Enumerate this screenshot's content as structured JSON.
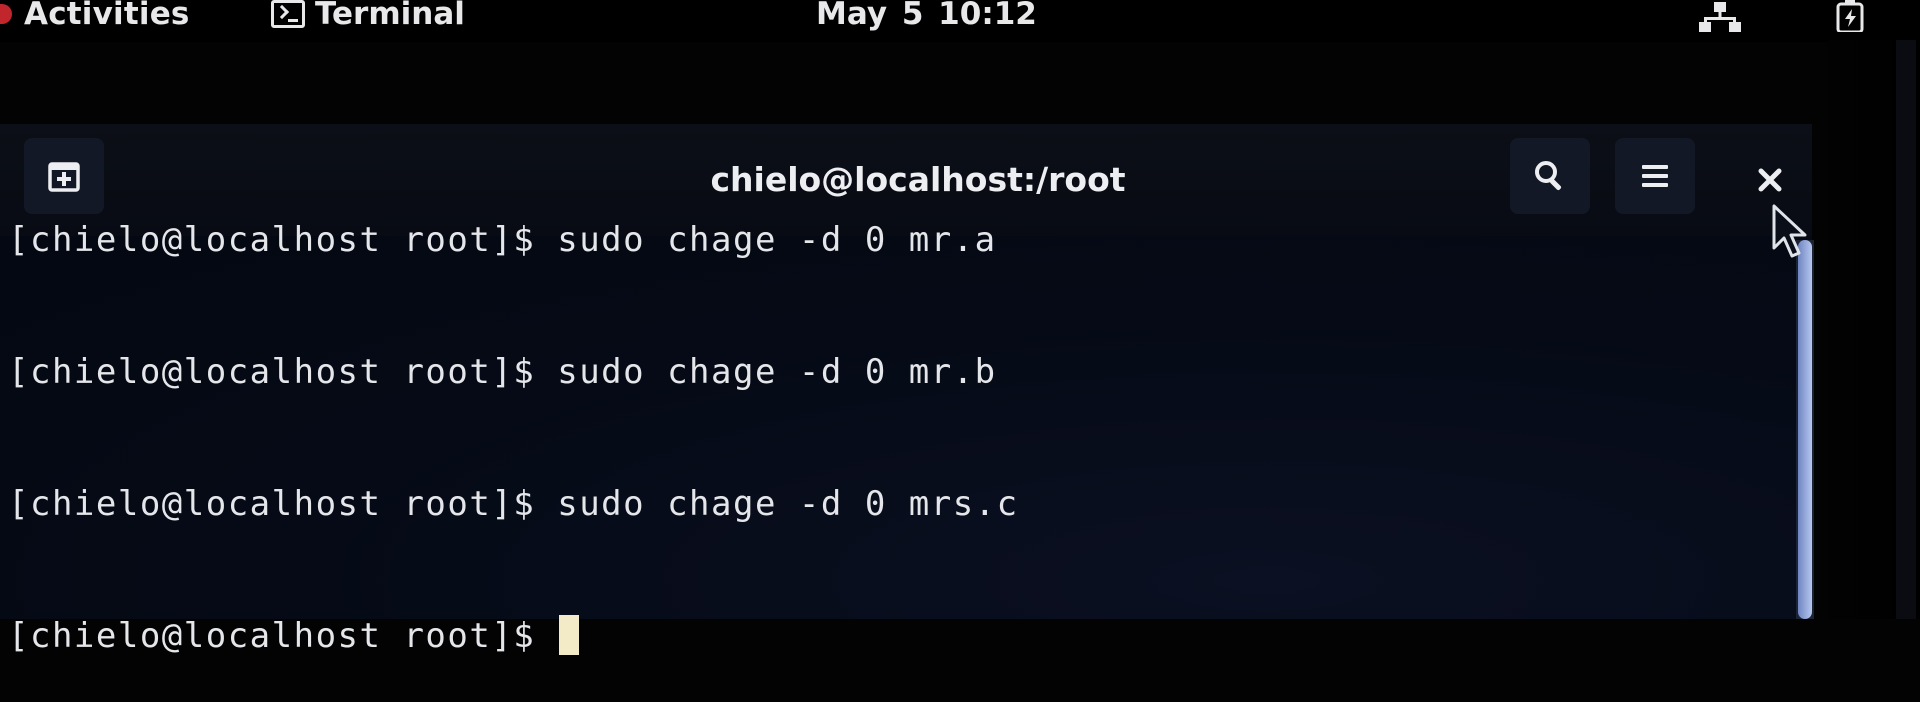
{
  "topbar": {
    "activities_label": "Activities",
    "app_menu_label": "Terminal",
    "clock": "May 5  10:12"
  },
  "window": {
    "title": "chielo@localhost:/root"
  },
  "terminal": {
    "lines": [
      "[chielo@localhost root]$ sudo chage -d 0 mr.a",
      "[chielo@localhost root]$ sudo chage -d 0 mr.b",
      "[chielo@localhost root]$ sudo chage -d 0 mrs.c",
      "[chielo@localhost root]$ "
    ]
  },
  "icons": {
    "top": [
      "activities-indicator-icon",
      "terminal-app-icon",
      "network-icon",
      "power-icon"
    ],
    "headerbar": [
      "new-tab-icon",
      "search-icon",
      "hamburger-menu-icon",
      "close-icon"
    ]
  },
  "colors": {
    "background": "#050b17",
    "text": "#e4e6ea",
    "cursor": "#f3eac8",
    "scrollbar_thumb": "#8ea3d8"
  }
}
